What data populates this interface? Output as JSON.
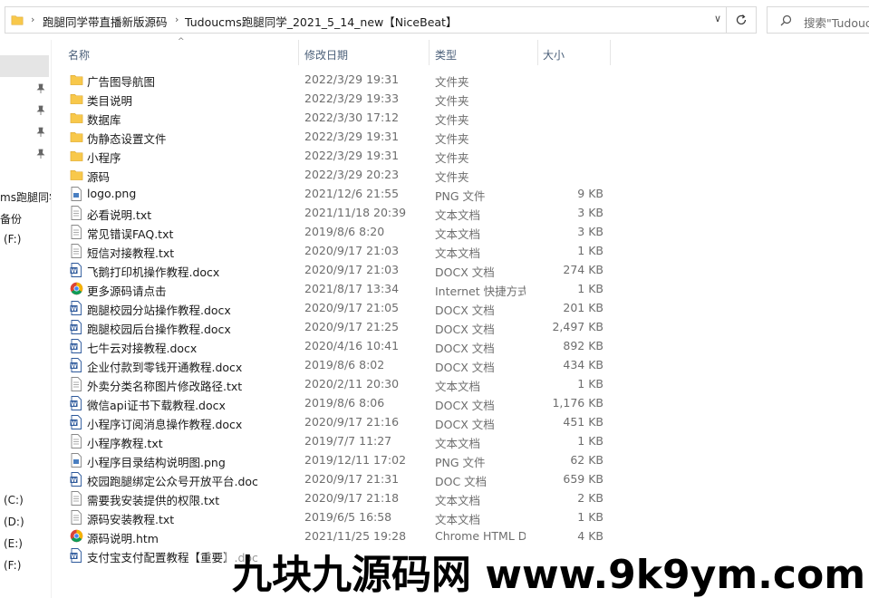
{
  "address_bar": {
    "crumbs": [
      "跑腿同学带直播新版源码",
      "Tudoucms跑腿同学_2021_5_14_new【NiceBeat】"
    ],
    "search_placeholder": "搜索\"Tudouc"
  },
  "nav_pane": {
    "items": [
      {
        "label": "ms跑腿同学"
      },
      {
        "label": "备份"
      },
      {
        "label": "(F:)"
      },
      {
        "label": "(C:)"
      },
      {
        "label": "(D:)"
      },
      {
        "label": "(E:)"
      },
      {
        "label": "(F:)"
      }
    ]
  },
  "columns": {
    "name": "名称",
    "date": "修改日期",
    "type": "类型",
    "size": "大小"
  },
  "files": [
    {
      "name": "广告图导航图",
      "date": "2022/3/29 19:31",
      "type": "文件夹",
      "size": "",
      "icon": "folder-icon"
    },
    {
      "name": "类目说明",
      "date": "2022/3/29 19:33",
      "type": "文件夹",
      "size": "",
      "icon": "folder-icon"
    },
    {
      "name": "数据库",
      "date": "2022/3/30 17:12",
      "type": "文件夹",
      "size": "",
      "icon": "folder-icon"
    },
    {
      "name": "伪静态设置文件",
      "date": "2022/3/29 19:31",
      "type": "文件夹",
      "size": "",
      "icon": "folder-icon"
    },
    {
      "name": "小程序",
      "date": "2022/3/29 19:31",
      "type": "文件夹",
      "size": "",
      "icon": "folder-icon"
    },
    {
      "name": "源码",
      "date": "2022/3/29 20:23",
      "type": "文件夹",
      "size": "",
      "icon": "folder-icon"
    },
    {
      "name": "logo.png",
      "date": "2021/12/6 21:55",
      "type": "PNG 文件",
      "size": "9 KB",
      "icon": "image-file-icon"
    },
    {
      "name": "必看说明.txt",
      "date": "2021/11/18 20:39",
      "type": "文本文档",
      "size": "3 KB",
      "icon": "text-file-icon"
    },
    {
      "name": "常见错误FAQ.txt",
      "date": "2019/8/6 8:20",
      "type": "文本文档",
      "size": "3 KB",
      "icon": "text-file-icon"
    },
    {
      "name": "短信对接教程.txt",
      "date": "2020/9/17 21:03",
      "type": "文本文档",
      "size": "1 KB",
      "icon": "text-file-icon"
    },
    {
      "name": "飞鹅打印机操作教程.docx",
      "date": "2020/9/17 21:03",
      "type": "DOCX 文档",
      "size": "274 KB",
      "icon": "word-file-icon"
    },
    {
      "name": "更多源码请点击",
      "date": "2021/8/17 13:34",
      "type": "Internet 快捷方式",
      "size": "1 KB",
      "icon": "chrome-icon"
    },
    {
      "name": "跑腿校园分站操作教程.docx",
      "date": "2020/9/17 21:05",
      "type": "DOCX 文档",
      "size": "201 KB",
      "icon": "word-file-icon"
    },
    {
      "name": "跑腿校园后台操作教程.docx",
      "date": "2020/9/17 21:25",
      "type": "DOCX 文档",
      "size": "2,497 KB",
      "icon": "word-file-icon"
    },
    {
      "name": "七牛云对接教程.docx",
      "date": "2020/4/16 10:41",
      "type": "DOCX 文档",
      "size": "892 KB",
      "icon": "word-file-icon"
    },
    {
      "name": "企业付款到零钱开通教程.docx",
      "date": "2019/8/6 8:02",
      "type": "DOCX 文档",
      "size": "434 KB",
      "icon": "word-file-icon"
    },
    {
      "name": "外卖分类名称图片修改路径.txt",
      "date": "2020/2/11 20:30",
      "type": "文本文档",
      "size": "1 KB",
      "icon": "text-file-icon"
    },
    {
      "name": "微信api证书下载教程.docx",
      "date": "2019/8/6 8:06",
      "type": "DOCX 文档",
      "size": "1,176 KB",
      "icon": "word-file-icon"
    },
    {
      "name": "小程序订阅消息操作教程.docx",
      "date": "2020/9/17 21:16",
      "type": "DOCX 文档",
      "size": "451 KB",
      "icon": "word-file-icon"
    },
    {
      "name": "小程序教程.txt",
      "date": "2019/7/7 11:27",
      "type": "文本文档",
      "size": "1 KB",
      "icon": "text-file-icon"
    },
    {
      "name": "小程序目录结构说明图.png",
      "date": "2019/12/11 17:02",
      "type": "PNG 文件",
      "size": "62 KB",
      "icon": "image-file-icon"
    },
    {
      "name": "校园跑腿绑定公众号开放平台.doc",
      "date": "2020/9/17 21:31",
      "type": "DOC 文档",
      "size": "659 KB",
      "icon": "word-file-icon"
    },
    {
      "name": "需要我安装提供的权限.txt",
      "date": "2020/9/17 21:18",
      "type": "文本文档",
      "size": "2 KB",
      "icon": "text-file-icon"
    },
    {
      "name": "源码安装教程.txt",
      "date": "2019/6/5 16:58",
      "type": "文本文档",
      "size": "1 KB",
      "icon": "text-file-icon"
    },
    {
      "name": "源码说明.htm",
      "date": "2021/11/25 19:28",
      "type": "Chrome HTML D...",
      "size": "4 KB",
      "icon": "chrome-icon"
    },
    {
      "name": "支付宝支付配置教程【重要】.doc",
      "date": "",
      "type": "",
      "size": "",
      "icon": "word-file-icon"
    }
  ],
  "watermark": "九块九源码网 www.9k9ym.com",
  "colors": {
    "folder": "#f8c84b",
    "header_text": "#4c607a",
    "secondary_text": "#6d6d6d",
    "word_blue": "#2b579a"
  }
}
